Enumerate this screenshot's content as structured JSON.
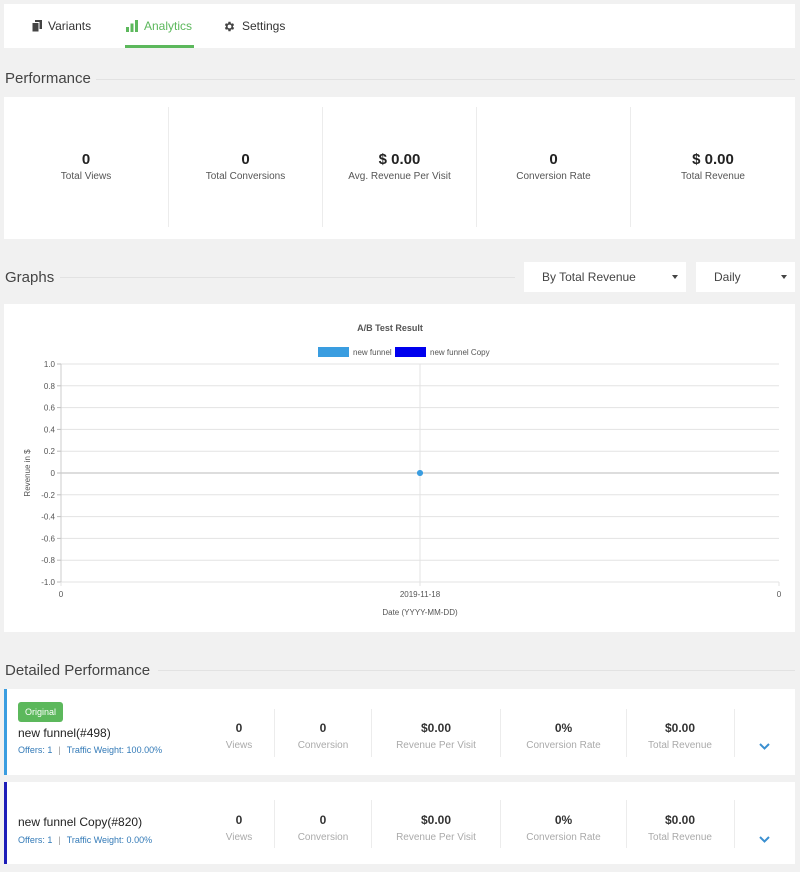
{
  "tabs": [
    {
      "label": "Variants",
      "icon": "copy-icon"
    },
    {
      "label": "Analytics",
      "icon": "bar-chart-icon",
      "active": true
    },
    {
      "label": "Settings",
      "icon": "gear-icon"
    }
  ],
  "performance": {
    "title": "Performance",
    "stats": [
      {
        "value": "0",
        "label": "Total Views"
      },
      {
        "value": "0",
        "label": "Total Conversions"
      },
      {
        "value": "$ 0.00",
        "label": "Avg. Revenue Per Visit"
      },
      {
        "value": "0",
        "label": "Conversion Rate"
      },
      {
        "value": "$ 0.00",
        "label": "Total Revenue"
      }
    ]
  },
  "graphs": {
    "title": "Graphs",
    "metric_select": "By Total Revenue",
    "period_select": "Daily"
  },
  "chart_data": {
    "type": "line",
    "title": "A/B Test Result",
    "xlabel": "Date (YYYY-MM-DD)",
    "ylabel": "Revenue in $",
    "x_ticks": [
      "0",
      "2019-11-18",
      "0"
    ],
    "y_ticks": [
      "1.0",
      "0.8",
      "0.6",
      "0.4",
      "0.2",
      "0",
      "-0.2",
      "-0.4",
      "-0.6",
      "-0.8",
      "-1.0"
    ],
    "ylim": [
      -1,
      1
    ],
    "x": [
      "2019-11-18"
    ],
    "series": [
      {
        "name": "new funnel",
        "values": [
          0
        ],
        "color": "#3a9de0"
      },
      {
        "name": "new funnel Copy",
        "values": [
          0
        ],
        "color": "#0000ee"
      }
    ],
    "legend": "top",
    "grid": true
  },
  "detailed": {
    "title": "Detailed Performance",
    "rows": [
      {
        "badge": "Original",
        "name": "new funnel(#498)",
        "offers": "Offers: 1",
        "sep": "|",
        "weight": "Traffic Weight: 100.00%",
        "color": "#3a9de0",
        "metrics": [
          {
            "value": "0",
            "label": "Views"
          },
          {
            "value": "0",
            "label": "Conversion"
          },
          {
            "value": "$0.00",
            "label": "Revenue Per Visit"
          },
          {
            "value": "0%",
            "label": "Conversion Rate"
          },
          {
            "value": "$0.00",
            "label": "Total Revenue"
          }
        ]
      },
      {
        "name": "new funnel Copy(#820)",
        "offers": "Offers: 1",
        "sep": "|",
        "weight": "Traffic Weight: 0.00%",
        "color": "#1d1db8",
        "metrics": [
          {
            "value": "0",
            "label": "Views"
          },
          {
            "value": "0",
            "label": "Conversion"
          },
          {
            "value": "$0.00",
            "label": "Revenue Per Visit"
          },
          {
            "value": "0%",
            "label": "Conversion Rate"
          },
          {
            "value": "$0.00",
            "label": "Total Revenue"
          }
        ]
      }
    ]
  }
}
